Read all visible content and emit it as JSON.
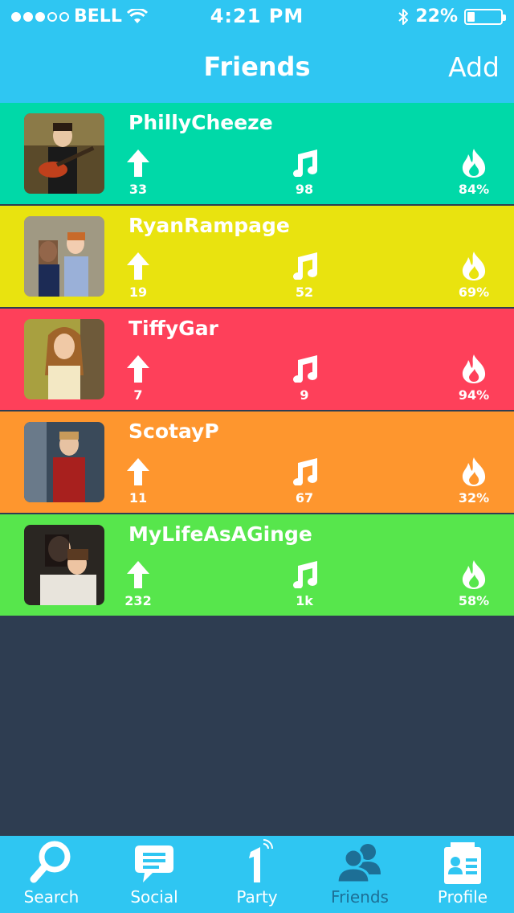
{
  "status": {
    "carrier": "BELL",
    "time": "4:21 PM",
    "battery": "22%",
    "battery_level": 0.22
  },
  "nav": {
    "title": "Friends",
    "add_label": "Add"
  },
  "friends": [
    {
      "name": "PhillyCheeze",
      "up": "33",
      "music": "98",
      "hot": "84%",
      "color": "#00d9a8"
    },
    {
      "name": "RyanRampage",
      "up": "19",
      "music": "52",
      "hot": "69%",
      "color": "#e9e30f"
    },
    {
      "name": "TiffyGar",
      "up": "7",
      "music": "9",
      "hot": "94%",
      "color": "#fe405a"
    },
    {
      "name": "ScotayP",
      "up": "11",
      "music": "67",
      "hot": "32%",
      "color": "#fe962e"
    },
    {
      "name": "MyLifeAsAGinge",
      "up": "232",
      "music": "1k",
      "hot": "58%",
      "color": "#57e64c"
    }
  ],
  "tabs": [
    {
      "label": "Search",
      "icon": "search-icon",
      "active": false
    },
    {
      "label": "Social",
      "icon": "chat-bubble-icon",
      "active": false
    },
    {
      "label": "Party",
      "icon": "party-one-icon",
      "active": false
    },
    {
      "label": "Friends",
      "icon": "people-icon",
      "active": true
    },
    {
      "label": "Profile",
      "icon": "id-card-icon",
      "active": false
    }
  ],
  "colors": {
    "accent": "#2fc6f2",
    "background": "#2e3d51",
    "active_tab": "#1d6f96"
  }
}
